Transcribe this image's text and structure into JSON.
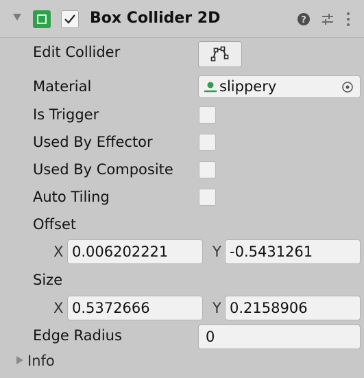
{
  "component": {
    "title": "Box Collider 2D",
    "enabled_checked": true
  },
  "properties": {
    "edit_collider": {
      "label": "Edit Collider"
    },
    "material": {
      "label": "Material",
      "value": "slippery"
    },
    "is_trigger": {
      "label": "Is Trigger",
      "checked": false
    },
    "used_by_effector": {
      "label": "Used By Effector",
      "checked": false
    },
    "used_by_composite": {
      "label": "Used By Composite",
      "checked": false
    },
    "auto_tiling": {
      "label": "Auto Tiling",
      "checked": false
    },
    "offset": {
      "label": "Offset",
      "x_label": "X",
      "x_value": "0.006202221",
      "y_label": "Y",
      "y_value": "-0.5431261"
    },
    "size": {
      "label": "Size",
      "x_label": "X",
      "x_value": "0.5372666",
      "y_label": "Y",
      "y_value": "0.2158906"
    },
    "edge_radius": {
      "label": "Edge Radius",
      "value": "0"
    },
    "info": {
      "label": "Info"
    }
  },
  "colors": {
    "panel_bg": "#c8c8c8",
    "field_bg": "#f1f1f1",
    "component_icon": "#2ea24a",
    "material_icon": "#2e9d4d"
  },
  "icons": [
    "foldout-arrow-down-icon",
    "box-collider-icon",
    "checkmark-icon",
    "help-icon",
    "preset-sliders-icon",
    "kebab-menu-icon",
    "edit-collider-icon",
    "material-icon",
    "object-picker-icon",
    "foldout-arrow-right-icon"
  ]
}
